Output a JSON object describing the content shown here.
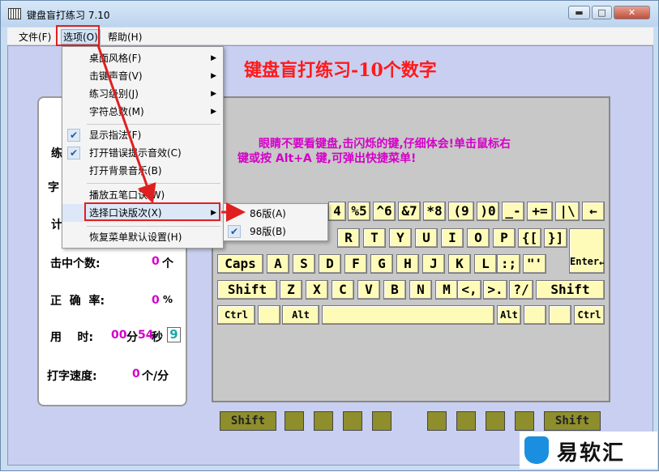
{
  "window": {
    "title": "键盘盲打练习 7.10",
    "min_label": "▬",
    "max_label": "□",
    "close_label": "✕"
  },
  "menubar": {
    "file": "文件(F)",
    "options": "选项(O)",
    "help": "帮助(H)"
  },
  "heading": "键盘盲打练习-10个数字",
  "message": {
    "line1": "眼睛不要看键盘,击闪烁的键,仔细体会!单击鼠标右",
    "line2": "键或按 Alt+A 键,可弹出快捷菜单!"
  },
  "stats": {
    "partial1": "练",
    "partial2": "字",
    "partial3": "计",
    "hits_label": "击中个数:",
    "hits_value": "0",
    "hits_unit": "个",
    "accuracy_label": "正  确  率:",
    "accuracy_value": "0",
    "accuracy_unit": "%",
    "time_label": "用    时:",
    "time_min": "00",
    "time_min_unit": "分",
    "time_sec": "54",
    "time_sec_unit": "秒",
    "time_box": "9",
    "speed_label": "打字速度:",
    "speed_value": "0",
    "speed_unit": "个/分"
  },
  "dropdown": {
    "items": [
      {
        "label": "桌面风格(F)",
        "submenu": true
      },
      {
        "label": "击键声音(V)",
        "submenu": true
      },
      {
        "label": "练习级别(J)",
        "submenu": true
      },
      {
        "label": "字符总数(M)",
        "submenu": true
      },
      {
        "label": "显示指法(F)",
        "checked": true
      },
      {
        "label": "打开错误提示音效(C)",
        "checked": true
      },
      {
        "label": "打开背景音乐(B)"
      },
      {
        "label": "播放五笔口诀(W)"
      },
      {
        "label": "选择口诀版次(X)",
        "submenu": true
      },
      {
        "label": "恢复菜单默认设置(H)"
      }
    ]
  },
  "submenu": {
    "items": [
      {
        "label": "86版(A)",
        "checked": false
      },
      {
        "label": "98版(B)",
        "checked": true
      }
    ]
  },
  "keys": {
    "row1": [
      "4",
      "%5",
      "^6",
      "&7",
      "*8",
      "(9",
      ")0",
      "_-",
      "+=",
      "|\\",
      "←"
    ],
    "row2": [
      "R",
      "T",
      "Y",
      "U",
      "I",
      "O",
      "P",
      "{[",
      "}]",
      "Enter↵"
    ],
    "row3": [
      "Caps",
      "A",
      "S",
      "D",
      "F",
      "G",
      "H",
      "J",
      "K",
      "L",
      ":;",
      "\"'"
    ],
    "row4": [
      "Shift",
      "Z",
      "X",
      "C",
      "V",
      "B",
      "N",
      "M",
      "<,",
      ">.",
      "?/",
      "Shift"
    ],
    "row5": [
      "Ctrl",
      "",
      "Alt",
      "",
      "Alt",
      "",
      "",
      "Ctrl"
    ]
  },
  "finger_bar": {
    "left": "Shift",
    "right": "Shift"
  },
  "watermark": "易软汇",
  "colors": {
    "heading": "#ff1a1a",
    "magenta": "#d400c8",
    "key_face": "#fefbb8",
    "highlight": "#e02020"
  }
}
